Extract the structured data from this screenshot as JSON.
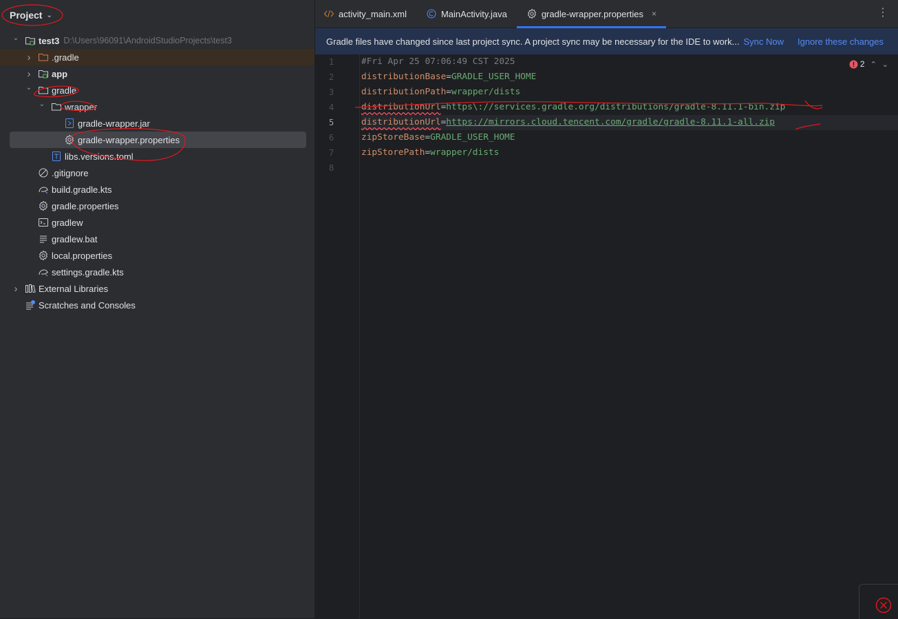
{
  "sidebar": {
    "title": "Project",
    "tree": [
      {
        "label": "test3",
        "path": "D:\\Users\\96091\\AndroidStudioProjects\\test3",
        "icon": "module-folder-icon",
        "depth": 0,
        "expanded": true,
        "bold": true
      },
      {
        "label": ".gradle",
        "icon": "folder-orange-icon",
        "depth": 1,
        "collapsed": true
      },
      {
        "label": "app",
        "icon": "module-folder-icon",
        "depth": 1,
        "collapsed": true,
        "bold": true
      },
      {
        "label": "gradle",
        "icon": "folder-icon",
        "depth": 1,
        "expanded": true
      },
      {
        "label": "wrapper",
        "icon": "folder-icon",
        "depth": 2,
        "expanded": true
      },
      {
        "label": "gradle-wrapper.jar",
        "icon": "jar-file-icon",
        "depth": 3
      },
      {
        "label": "gradle-wrapper.properties",
        "icon": "gear-file-icon",
        "depth": 3,
        "selected": true
      },
      {
        "label": "libs.versions.toml",
        "icon": "toml-file-icon",
        "depth": 2
      },
      {
        "label": ".gitignore",
        "icon": "ignore-file-icon",
        "depth": 1
      },
      {
        "label": "build.gradle.kts",
        "icon": "gradle-kts-icon",
        "depth": 1
      },
      {
        "label": "gradle.properties",
        "icon": "gear-file-icon",
        "depth": 1
      },
      {
        "label": "gradlew",
        "icon": "terminal-file-icon",
        "depth": 1
      },
      {
        "label": "gradlew.bat",
        "icon": "text-file-icon",
        "depth": 1
      },
      {
        "label": "local.properties",
        "icon": "gear-file-icon",
        "depth": 1
      },
      {
        "label": "settings.gradle.kts",
        "icon": "gradle-kts-icon",
        "depth": 1
      },
      {
        "label": "External Libraries",
        "icon": "library-icon",
        "depth": 0,
        "collapsed": true
      },
      {
        "label": "Scratches and Consoles",
        "icon": "scratches-icon",
        "depth": 0
      }
    ]
  },
  "tabs": [
    {
      "label": "activity_main.xml",
      "icon": "xml-icon"
    },
    {
      "label": "MainActivity.java",
      "icon": "class-icon"
    },
    {
      "label": "gradle-wrapper.properties",
      "icon": "gear-icon",
      "active": true,
      "close": "×"
    }
  ],
  "banner": {
    "message": "Gradle files have changed since last project sync. A project sync may be necessary for the IDE to work...",
    "sync_now": "Sync Now",
    "ignore": "Ignore these changes"
  },
  "inspection": {
    "error_count": "2"
  },
  "editor": {
    "current_line": 5,
    "lines": [
      {
        "num": "1",
        "comment": "#Fri Apr 25 07:06:49 CST 2025"
      },
      {
        "num": "2",
        "key": "distributionBase",
        "value": "GRADLE_USER_HOME"
      },
      {
        "num": "3",
        "key": "distributionPath",
        "value": "wrapper/dists"
      },
      {
        "num": "4",
        "key": "distributionUrl",
        "value": "https\\://services.gradle.org/distributions/gradle-8.11.1-bin.zip",
        "error": true
      },
      {
        "num": "5",
        "key": "distributionUrl",
        "value": "https://mirrors.cloud.tencent.com/gradle/gradle-8.11.1-all.zip",
        "error": true
      },
      {
        "num": "6",
        "key": "zipStoreBase",
        "value": "GRADLE_USER_HOME"
      },
      {
        "num": "7",
        "key": "zipStorePath",
        "value": "wrapper/dists"
      },
      {
        "num": "8"
      }
    ]
  },
  "colors": {
    "accent": "#3574f0",
    "link": "#548af7",
    "key": "#cf8e6d",
    "value": "#6aab73",
    "annotation": "#e0191f"
  }
}
